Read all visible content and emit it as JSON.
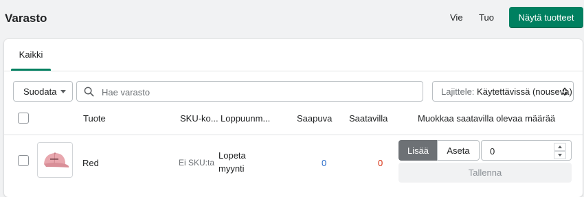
{
  "page": {
    "title": "Varasto"
  },
  "header": {
    "export_label": "Vie",
    "import_label": "Tuo",
    "primary_label": "Näytä tuotteet",
    "primary_color": "#008060"
  },
  "tabs": [
    {
      "label": "Kaikki",
      "selected": true
    }
  ],
  "toolbar": {
    "filter_label": "Suodata",
    "search_placeholder": "Hae varasto",
    "sort_label": "Lajittele:",
    "sort_value": "Käytettävissä (nouseva)"
  },
  "table": {
    "headers": {
      "product": "Tuote",
      "sku": "SKU-ko...",
      "discontinued": "Loppuunm...",
      "incoming": "Saapuva",
      "available": "Saatavilla",
      "edit": "Muokkaa saatavilla olevaa määrää"
    },
    "rows": [
      {
        "product": "Red",
        "sku": "Ei SKU:ta",
        "discontinued_line1": "Lopeta",
        "discontinued_line2": "myynti",
        "incoming": "0",
        "available": "0",
        "incoming_color": "#2c6ecb",
        "available_color": "#d72c0d",
        "add_label": "Lisää",
        "set_label": "Aseta",
        "quantity": "0",
        "save_label": "Tallenna",
        "image_icon": "pink-cap-image"
      }
    ]
  }
}
